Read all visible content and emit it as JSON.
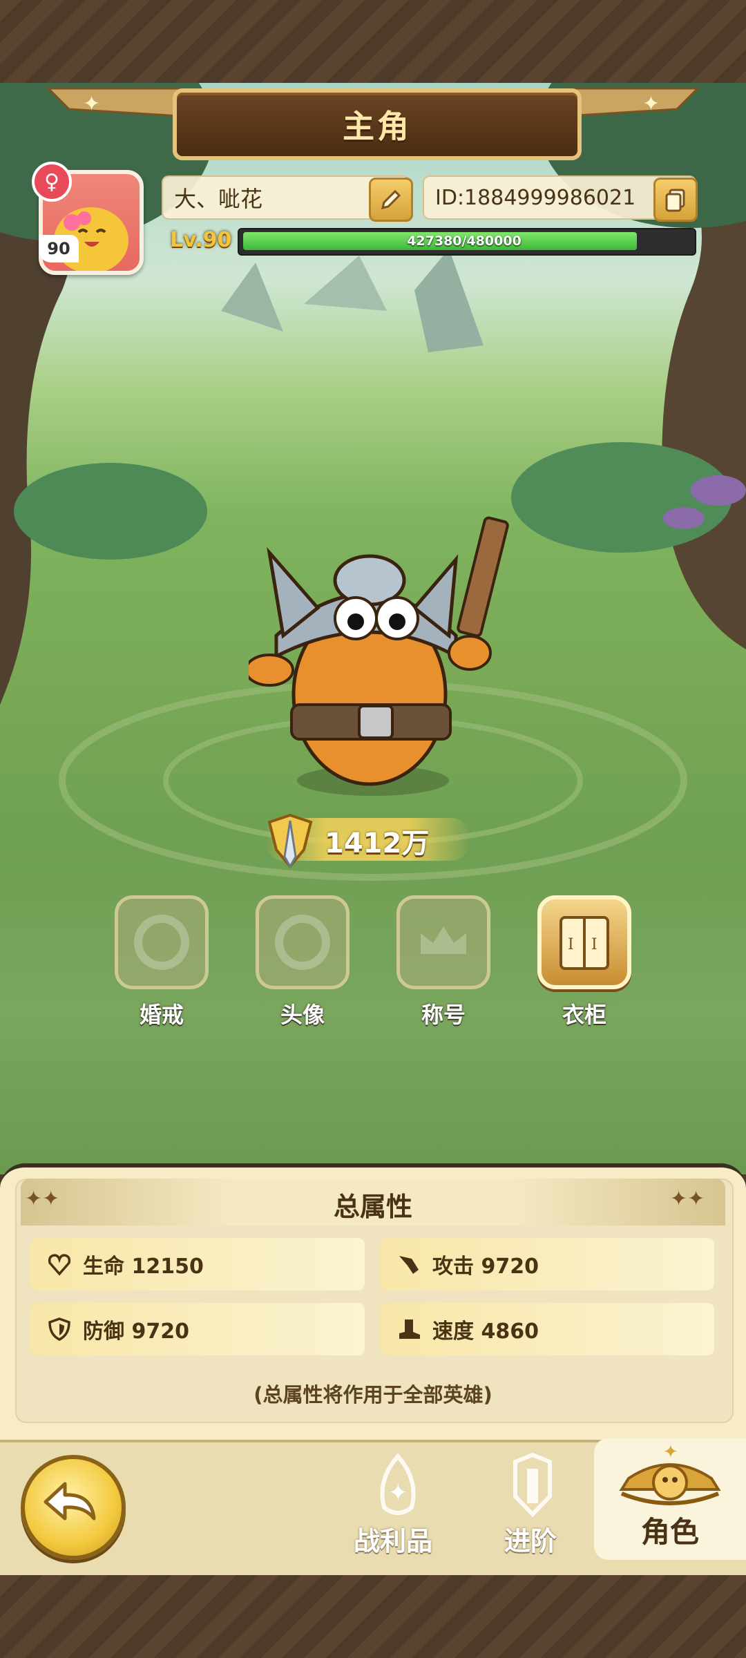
{
  "header": {
    "title": "主角"
  },
  "profile": {
    "avatar_level": "90",
    "gender_symbol": "♀",
    "name": "大、呲花",
    "id_text": "ID:1884999986021",
    "level_label": "Lv.90",
    "xp_text": "427380/480000",
    "xp_fraction": 0.8904
  },
  "power": {
    "value": "1412万"
  },
  "features": [
    {
      "label": "婚戒",
      "active": false
    },
    {
      "label": "头像",
      "active": false
    },
    {
      "label": "称号",
      "active": false
    },
    {
      "label": "衣柜",
      "active": true
    }
  ],
  "attributes": {
    "title": "总属性",
    "stats": [
      {
        "icon": "heart-icon",
        "label": "生命 12150"
      },
      {
        "icon": "attack-icon",
        "label": "攻击 9720"
      },
      {
        "icon": "shield-icon",
        "label": "防御 9720"
      },
      {
        "icon": "boot-icon",
        "label": "速度 4860"
      }
    ],
    "note": "(总属性将作用于全部英雄)"
  },
  "nav": {
    "items": [
      {
        "label": "战利品",
        "active": false
      },
      {
        "label": "进阶",
        "active": false
      },
      {
        "label": "角色",
        "active": true
      }
    ]
  },
  "colors": {
    "accent": "#f3c93e",
    "xp": "#4fcf48",
    "panel": "#f7ecc6"
  }
}
